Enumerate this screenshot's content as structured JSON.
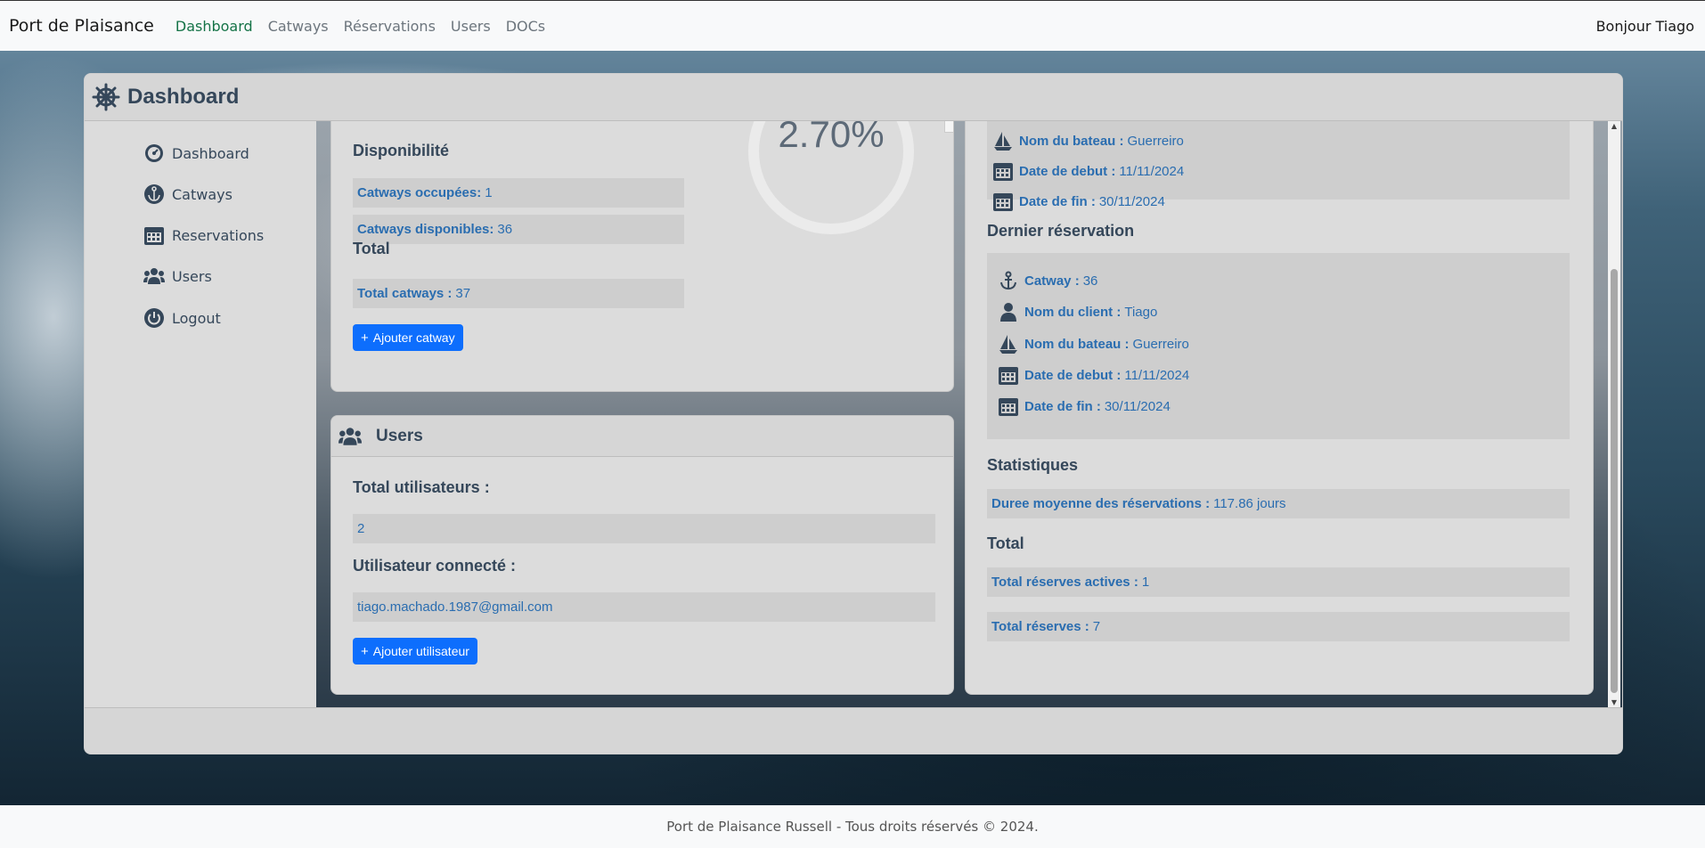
{
  "navbar": {
    "brand": "Port de Plaisance",
    "links": [
      "Dashboard",
      "Catways",
      "Réservations",
      "Users",
      "DOCs"
    ],
    "greeting": "Bonjour Tiago"
  },
  "dashboard": {
    "title": "Dashboard"
  },
  "sidebar": {
    "items": [
      {
        "label": "Dashboard",
        "icon": "gauge-icon"
      },
      {
        "label": "Catways",
        "icon": "anchor-icon"
      },
      {
        "label": "Reservations",
        "icon": "calendar-icon"
      },
      {
        "label": "Users",
        "icon": "users-icon"
      },
      {
        "label": "Logout",
        "icon": "power-icon"
      }
    ]
  },
  "catways": {
    "occupancy_percent": "2.70%",
    "availability_title": "Disponibilité",
    "occupied_label": "Catways occupées:",
    "occupied_value": "1",
    "available_label": "Catways disponibles:",
    "available_value": "36",
    "total_title": "Total",
    "total_label": "Total catways :",
    "total_value": "37",
    "add_button": "Ajouter catway"
  },
  "users": {
    "title": "Users",
    "total_title": "Total utilisateurs :",
    "total_value": "2",
    "connected_title": "Utilisateur connecté :",
    "connected_value": "tiago.machado.1987@gmail.com",
    "add_button": "Ajouter utilisateur"
  },
  "reservations": {
    "current": {
      "boat_label": "Nom du bateau :",
      "boat_value": "Guerreiro",
      "start_label": "Date de debut :",
      "start_value": "11/11/2024",
      "end_label": "Date de fin :",
      "end_value": "30/11/2024"
    },
    "last_title": "Dernier réservation",
    "last": {
      "catway_label": "Catway :",
      "catway_value": "36",
      "client_label": "Nom du client :",
      "client_value": "Tiago",
      "boat_label": "Nom du bateau :",
      "boat_value": "Guerreiro",
      "start_label": "Date de debut :",
      "start_value": "11/11/2024",
      "end_label": "Date de fin :",
      "end_value": "30/11/2024"
    },
    "stats_title": "Statistiques",
    "avg_label": "Duree moyenne des réservations :",
    "avg_value": "117.86 jours",
    "total_title": "Total",
    "active_label": "Total réserves actives :",
    "active_value": "1",
    "all_label": "Total réserves :",
    "all_value": "7"
  },
  "footer": {
    "text": "Port de Plaisance Russell - Tous droits réservés © 2024."
  },
  "colors": {
    "accent": "#0d6efd",
    "active_nav": "#157347",
    "text_blue": "#2a6db0",
    "heading": "#35475a"
  }
}
